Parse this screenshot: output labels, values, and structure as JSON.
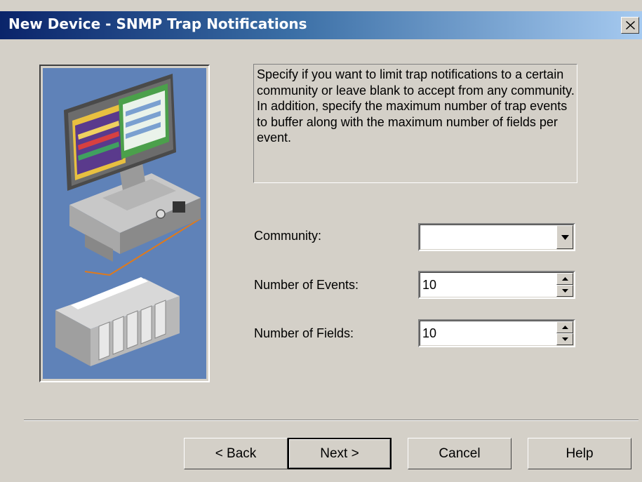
{
  "window": {
    "title": "New Device - SNMP Trap Notifications",
    "close_icon": "close-icon"
  },
  "illustration": {
    "icon": "pc-network-device-illustration",
    "background_color": "#5f82b8"
  },
  "description": "Specify if you want to limit trap notifications to a certain community or leave blank to accept from any community.  In addition, specify the maximum number of trap events to buffer along with the maximum number of fields per event.",
  "form": {
    "community": {
      "label": "Community:",
      "value": ""
    },
    "events": {
      "label": "Number of Events:",
      "value": "10"
    },
    "fields": {
      "label": "Number of Fields:",
      "value": "10"
    }
  },
  "buttons": {
    "back": "< Back",
    "next": "Next >",
    "cancel": "Cancel",
    "help": "Help"
  }
}
